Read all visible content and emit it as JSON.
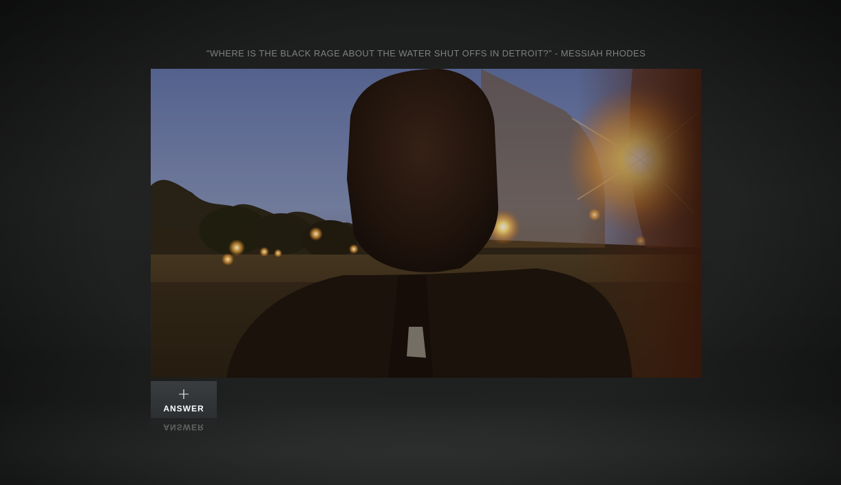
{
  "question": {
    "text": "\"WHERE IS THE BLACK RAGE ABOUT THE WATER SHUT OFFS IN DETROIT?\" - MESSIAH RHODES"
  },
  "video": {
    "description_icon": "video-player"
  },
  "answer_button": {
    "icon": "plus-icon",
    "icon_glyph": "+",
    "label": "ANSWER"
  },
  "colors": {
    "background": "#1d1e1e",
    "question_text": "#7f8080",
    "button_bg": "#33363a",
    "button_text": "#ffffff"
  }
}
